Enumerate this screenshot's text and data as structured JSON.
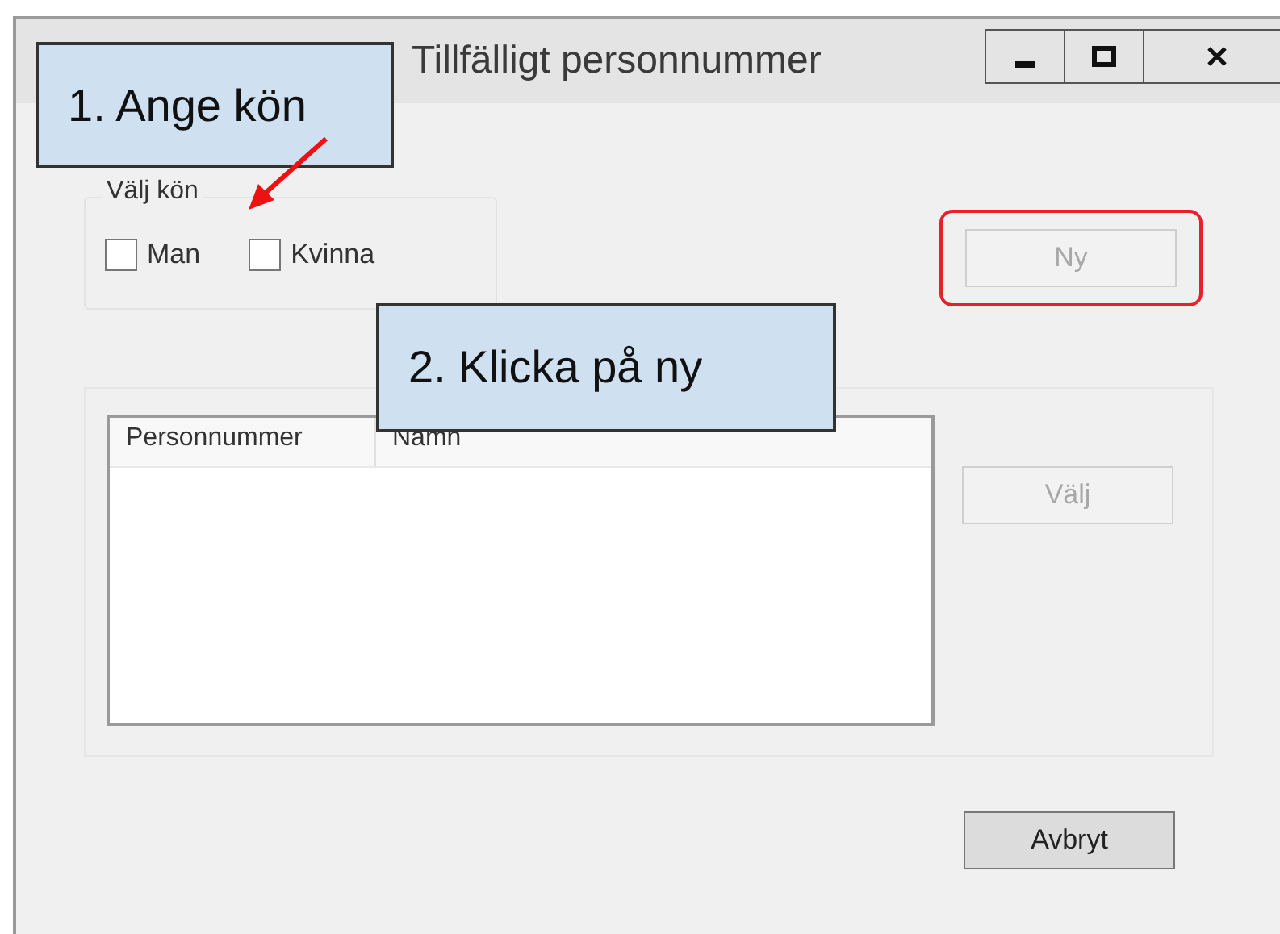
{
  "window": {
    "title": "Tillfälligt personnummer"
  },
  "gender_group": {
    "label": "Välj kön",
    "options": [
      {
        "label": "Man",
        "checked": false
      },
      {
        "label": "Kvinna",
        "checked": false
      }
    ]
  },
  "new_button": {
    "label": "Ny",
    "disabled": true,
    "highlighted": true
  },
  "table": {
    "columns": [
      "Personnummer",
      "Namn"
    ]
  },
  "choose_button": {
    "label": "Välj",
    "disabled": true
  },
  "cancel_button": {
    "label": "Avbryt",
    "disabled": false
  },
  "callouts": [
    {
      "text": "1. Ange kön"
    },
    {
      "text": "2. Klicka på ny"
    }
  ]
}
